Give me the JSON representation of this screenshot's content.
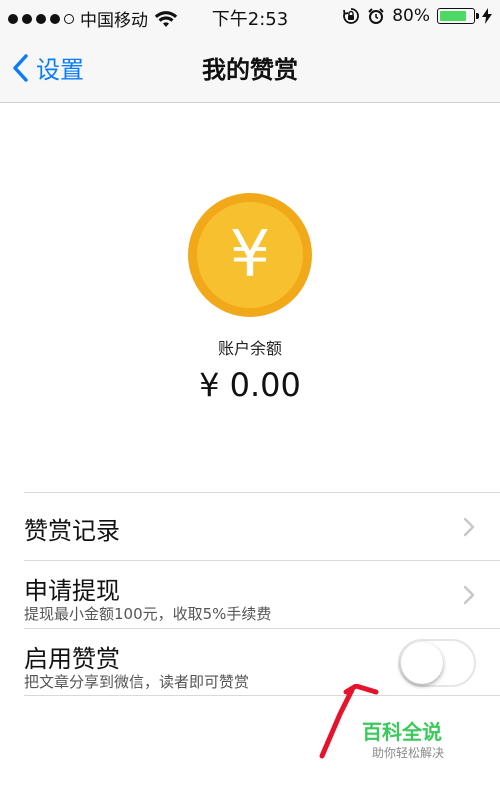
{
  "status_bar": {
    "carrier": "中国移动",
    "time": "下午2:53",
    "battery": "80%",
    "battery_level": 0.8,
    "signal_dots_filled": 4,
    "icons": [
      "wifi-icon",
      "rotation-lock-icon",
      "alarm-icon",
      "battery-icon",
      "charging-icon"
    ]
  },
  "nav": {
    "back_label": "设置",
    "title": "我的赞赏"
  },
  "balance": {
    "coin_symbol": "¥",
    "label": "账户余额",
    "value": "¥ 0.00"
  },
  "rows": [
    {
      "title": "赞赏记录"
    },
    {
      "title": "申请提现",
      "subtitle": "提现最小金额100元，收取5%手续费"
    },
    {
      "title": "启用赞赏",
      "subtitle": "把文章分享到微信，读者即可赞赏",
      "toggle_on": false
    }
  ],
  "watermark": {
    "title": "百科全说",
    "subtitle": "助你轻松解决"
  },
  "colors": {
    "accent_blue": "#0a7cf7",
    "coin_gold": "#f5b623",
    "battery_green": "#4cd964",
    "watermark_green": "#3ac95a",
    "annotation_red": "#e5142a"
  }
}
